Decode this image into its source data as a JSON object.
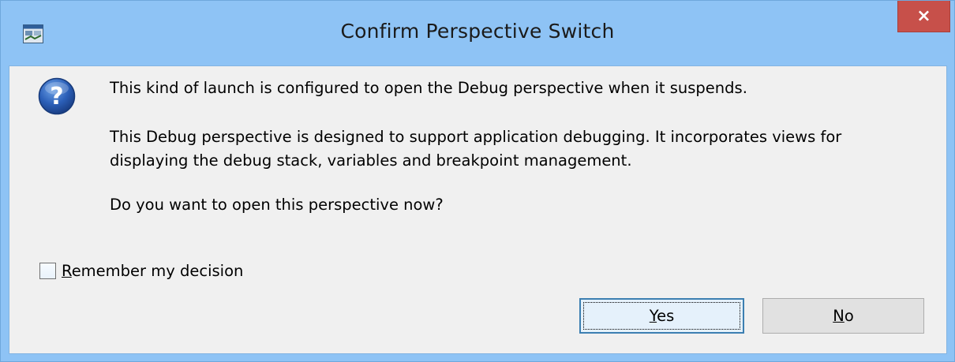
{
  "window": {
    "title": "Confirm Perspective Switch",
    "close_label": "×",
    "app_icon": "eclipse-window-icon"
  },
  "dialog": {
    "icon": "question-icon",
    "lines": [
      "This kind of launch is configured to open the Debug perspective when it suspends.",
      "This Debug perspective is designed to support application debugging.  It incorporates views for",
      "displaying the debug stack, variables and breakpoint management.",
      "Do you want to open this perspective now?"
    ],
    "remember": {
      "mnemonic": "R",
      "rest": "emember my decision",
      "checked": false
    },
    "buttons": {
      "yes": {
        "mnemonic": "Y",
        "rest": "es"
      },
      "no": {
        "mnemonic": "N",
        "rest": "o"
      }
    }
  },
  "colors": {
    "titlebar": "#8ec3f5",
    "close": "#c7504a",
    "client": "#f0f0f0"
  }
}
